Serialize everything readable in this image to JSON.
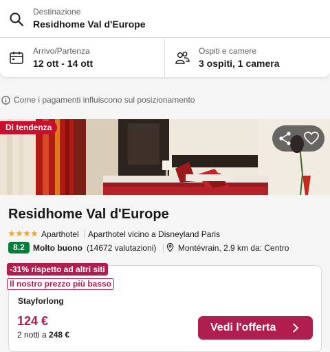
{
  "search": {
    "destination_label": "Destinazione",
    "destination_value": "Residhome Val d'Europe",
    "dates_label": "Arrivo/Partenza",
    "dates_value": "12 ott - 14 ott",
    "guests_label": "Ospiti e camere",
    "guests_value": "3 ospiti, 1 camera"
  },
  "info": {
    "text": "Come i pagamenti influiscono sul posizionamento"
  },
  "hotel": {
    "trend_badge": "Di tendenza",
    "name": "Residhome Val d'Europe",
    "stars": 4,
    "type": "Aparthotel",
    "description": "Aparthotel vicino a Disneyland Paris",
    "score": "8.2",
    "rating_word": "Molto buono",
    "rating_count": "(14672 valutazioni)",
    "location": "Montévrain, 2.9 km da: Centro"
  },
  "deal": {
    "discount_badge": "-31% rispetto ad altri siti",
    "best_price_badge": "Il nostro prezzo più basso",
    "provider": "Stayforlong",
    "price": "124 €",
    "total_prefix": "2 notti a",
    "total_value": "248 €",
    "cta_label": "Vedi l'offerta"
  },
  "colors": {
    "accent": "#b01e50",
    "trend_red": "#c8102e",
    "score_green": "#007f3b",
    "star_orange": "#f5a623"
  },
  "icons": {
    "destination": "search-icon",
    "dates": "calendar-icon",
    "guests": "people-icon",
    "info": "info-icon",
    "share": "share-icon",
    "favorite": "heart-icon",
    "location": "pin-icon",
    "cta": "chevron-right-icon"
  }
}
